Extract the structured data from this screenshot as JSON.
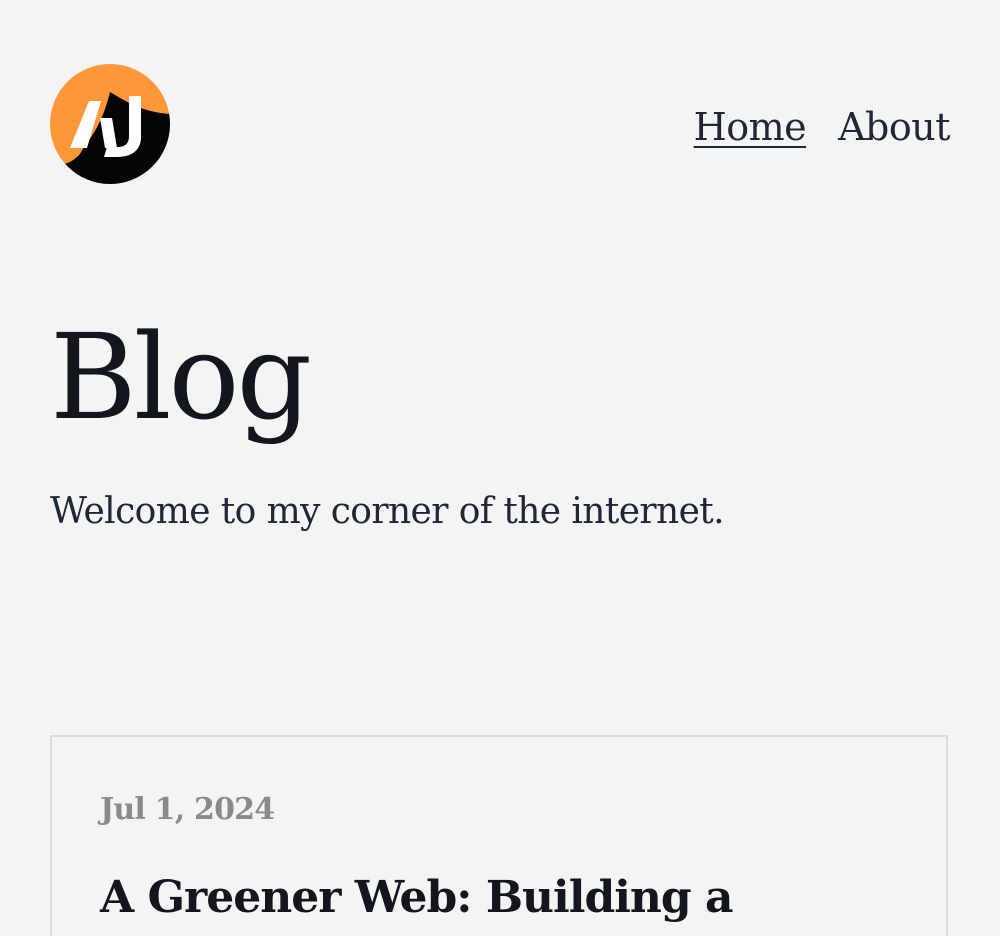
{
  "header": {
    "logo_text": "AJ",
    "nav": [
      {
        "label": "Home",
        "active": true
      },
      {
        "label": "About",
        "active": false
      }
    ]
  },
  "main": {
    "title": "Blog",
    "subtitle": "Welcome to my corner of the internet."
  },
  "posts": [
    {
      "date": "Jul 1, 2024",
      "title": "A Greener Web: Building a"
    }
  ],
  "colors": {
    "background": "#f4f4f4",
    "logo_orange": "#fd9738",
    "logo_black": "#050505",
    "text_dark": "#1f2636",
    "date_gray": "#8a8a8a",
    "card_border": "#dcdcdc"
  }
}
